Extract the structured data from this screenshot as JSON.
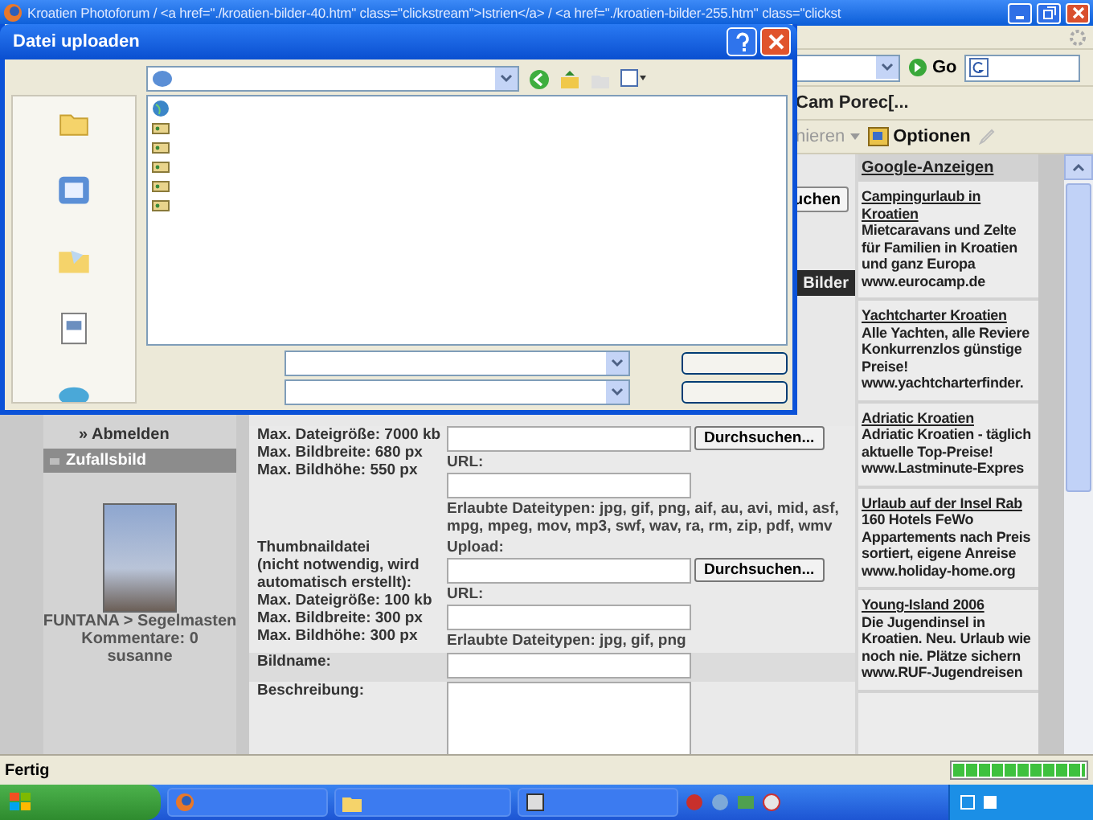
{
  "browser": {
    "title": "Kroatien Photoforum  /  <a href=\"./kroatien-bilder-40.htm\" class=\"clickstream\">Istrien</a>  /  <a href=\"./kroatien-bilder-255.htm\" class=\"clickst",
    "go": "Go",
    "link_fragment": "Cam Porec[...",
    "toolbar": [
      {
        "kind": "menu",
        "label": "nieren"
      },
      {
        "kind": "options",
        "label": "Optionen"
      }
    ]
  },
  "dialog": {
    "title": "Datei uploaden"
  },
  "sidebar": {
    "logout": "» Abmelden",
    "box_title": "Zufallsbild",
    "caption": [
      "FUNTANA > Segelmasten",
      "Kommentare: 0",
      "susanne"
    ]
  },
  "page_fragments": {
    "browse_button": "uchen",
    "bar_label": "Bilder"
  },
  "form": {
    "rows": [
      {
        "kind": "upload",
        "label_lines": [
          "Max. Dateigröße: 7000 kb",
          "Max. Bildbreite: 680 px",
          "Max. Bildhöhe: 550 px"
        ],
        "button": "Durchsuchen...",
        "url_label": "URL:",
        "types": "Erlaubte Dateitypen: jpg, gif, png, aif, au, avi, mid, asf, mpg, mpeg, mov, mp3, swf, wav, ra, rm, zip, pdf, wmv"
      },
      {
        "kind": "upload",
        "label_lines": [
          "Thumbnaildatei",
          "(nicht notwendig, wird automatisch erstellt):",
          "Max. Dateigröße: 100 kb",
          "Max. Bildbreite: 300 px",
          "Max. Bildhöhe: 300 px"
        ],
        "upload_label": "Upload:",
        "button": "Durchsuchen...",
        "url_label": "URL:",
        "types": "Erlaubte Dateitypen: jpg, gif, png"
      },
      {
        "kind": "text",
        "label_lines": [
          "Bildname:"
        ]
      },
      {
        "kind": "textarea",
        "label_lines": [
          "Beschreibung:"
        ]
      }
    ]
  },
  "ads": {
    "title": "Google-Anzeigen",
    "items": [
      {
        "headline": "Campingurlaub in Kroatien",
        "body": "Mietcaravans und Zelte für Familien in Kroatien und ganz Europa",
        "url": "www.eurocamp.de"
      },
      {
        "headline": "Yachtcharter Kroatien",
        "body": "Alle Yachten, alle Reviere Konkurrenzlos günstige Preise!",
        "url": "www.yachtcharterfinder."
      },
      {
        "headline": "Adriatic Kroatien",
        "body": "Adriatic Kroatien - täglich aktuelle Top-Preise!",
        "url": "www.Lastminute-Expres"
      },
      {
        "headline": "Urlaub auf der Insel Rab",
        "body": "160 Hotels FeWo Appartements nach Preis sortiert, eigene Anreise",
        "url": "www.holiday-home.org"
      },
      {
        "headline": "Young-Island 2006",
        "body": "Die Jugendinsel in Kroatien. Neu. Urlaub wie noch nie. Plätze sichern",
        "url": "www.RUF-Jugendreisen"
      }
    ]
  },
  "status_bar": {
    "text": "Fertig",
    "progress": {
      "level": 1
    }
  }
}
